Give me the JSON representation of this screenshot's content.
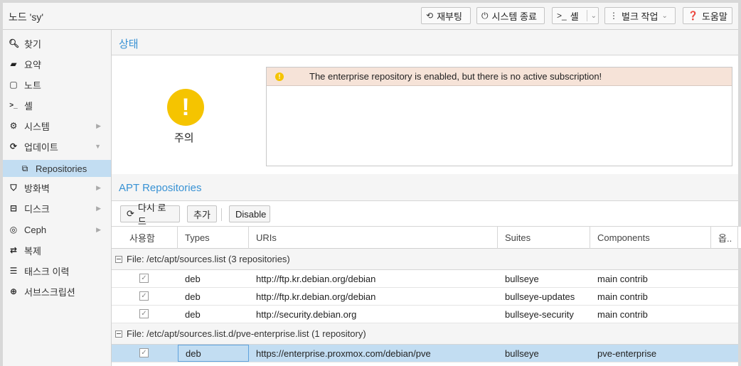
{
  "topbar": {
    "node_title": "노드 'sy'",
    "reboot_label": "재부팅",
    "shutdown_label": "시스템 종료",
    "shell_label": "셸",
    "bulk_label": "벌크 작업",
    "help_label": "도움말"
  },
  "sidebar": {
    "items": [
      {
        "label": "찾기",
        "icon": "search-icon"
      },
      {
        "label": "요약",
        "icon": "book-icon"
      },
      {
        "label": "노트",
        "icon": "note-icon"
      },
      {
        "label": "셸",
        "icon": "terminal-icon"
      },
      {
        "label": "시스템",
        "icon": "gears-icon"
      },
      {
        "label": "업데이트",
        "icon": "refresh-icon"
      },
      {
        "label": "Repositories",
        "icon": "files-icon"
      },
      {
        "label": "방화벽",
        "icon": "shield-icon"
      },
      {
        "label": "디스크",
        "icon": "hdd-icon"
      },
      {
        "label": "Ceph",
        "icon": "ceph-icon"
      },
      {
        "label": "복제",
        "icon": "retweet-icon"
      },
      {
        "label": "태스크 이력",
        "icon": "list-icon"
      },
      {
        "label": "서브스크립션",
        "icon": "support-icon"
      }
    ]
  },
  "status": {
    "header": "상태",
    "label": "주의",
    "alert_text": "The enterprise repository is enabled, but there is no active subscription!"
  },
  "apt": {
    "header": "APT Repositories",
    "reload_label": "다시 로드",
    "add_label": "추가",
    "disable_label": "Disable",
    "columns": [
      "사용함",
      "Types",
      "URIs",
      "Suites",
      "Components",
      "옵.."
    ],
    "groups": [
      {
        "title": "File: /etc/apt/sources.list (3 repositories)",
        "rows": [
          {
            "enabled": true,
            "type": "deb",
            "uri": "http://ftp.kr.debian.org/debian",
            "suite": "bullseye",
            "components": "main contrib"
          },
          {
            "enabled": true,
            "type": "deb",
            "uri": "http://ftp.kr.debian.org/debian",
            "suite": "bullseye-updates",
            "components": "main contrib"
          },
          {
            "enabled": true,
            "type": "deb",
            "uri": "http://security.debian.org",
            "suite": "bullseye-security",
            "components": "main contrib"
          }
        ]
      },
      {
        "title": "File: /etc/apt/sources.list.d/pve-enterprise.list (1 repository)",
        "rows": [
          {
            "enabled": true,
            "type": "deb",
            "uri": "https://enterprise.proxmox.com/debian/pve",
            "suite": "bullseye",
            "components": "pve-enterprise"
          }
        ]
      }
    ]
  },
  "colors": {
    "accent": "#3892d4",
    "warning": "#f5c400",
    "selected": "#c2ddf2",
    "alert_bg": "#f6e3d8"
  }
}
